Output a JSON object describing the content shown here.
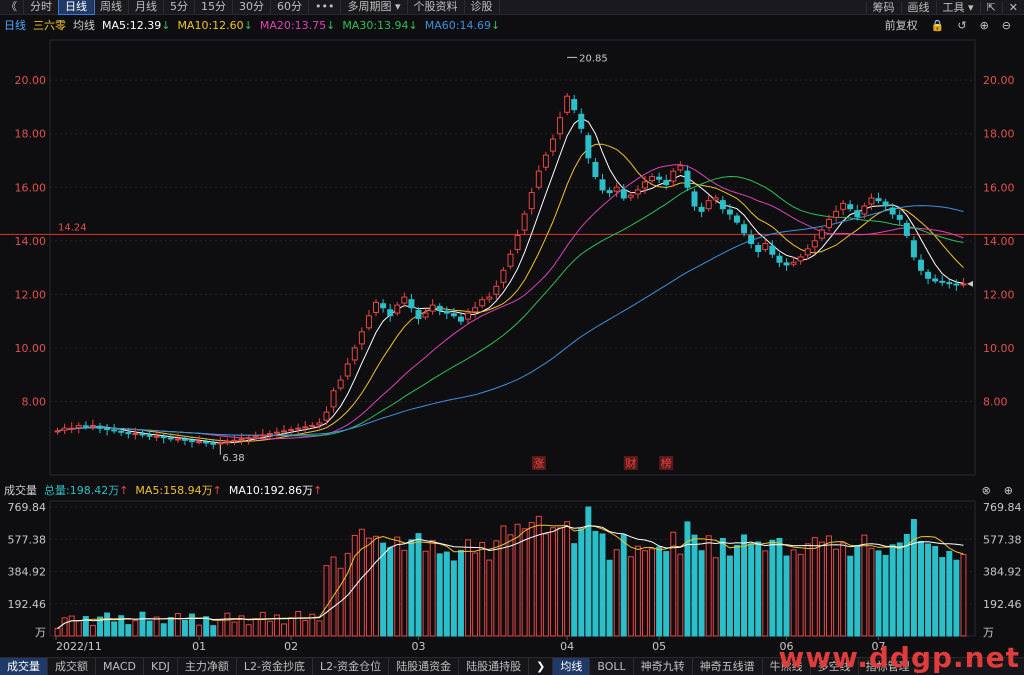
{
  "toolbar": {
    "back_glyph": "《",
    "tabs": [
      "分时",
      "日线",
      "周线",
      "月线",
      "5分",
      "15分",
      "30分",
      "60分",
      "•••",
      "多周期图 ▾",
      "个股资料",
      "诊股"
    ],
    "active_tab": "日线",
    "right": [
      "筹码",
      "画线",
      "工具 ▾"
    ]
  },
  "info": {
    "period": "日线",
    "name": "三六零",
    "ma_label": "均线",
    "ma5": "MA5:12.39",
    "ma10": "MA10:12.60",
    "ma20": "MA20:13.75",
    "ma30": "MA30:13.94",
    "ma60": "MA60:14.69",
    "adjust": "前复权"
  },
  "colors": {
    "up": "#e64545",
    "down": "#2bc0c9",
    "ma5": "#ffffff",
    "ma10": "#f2c12e",
    "ma20": "#e040b8",
    "ma30": "#2fbf5a",
    "ma60": "#3c90e0",
    "hline": "#d93636",
    "axis_text_red": "#e05050",
    "bg": "#0e0e10"
  },
  "chart_data": [
    {
      "type": "candlestick",
      "title": "",
      "ylim": [
        6,
        21.5
      ],
      "y_ticks": [
        "20.00",
        "18.00",
        "16.00",
        "14.00",
        "12.00",
        "10.00",
        "8.00"
      ],
      "x_ticks": [
        "2022/11",
        "01",
        "02",
        "03",
        "04",
        "05",
        "06",
        "07"
      ],
      "hline_value": "14.24",
      "max_label": "20.85",
      "min_label": "6.38",
      "event_markers": [
        "涨",
        "财",
        "榜"
      ],
      "close_series": [
        6.9,
        7.0,
        7.0,
        7.1,
        7.05,
        7.1,
        7.0,
        6.95,
        6.9,
        6.85,
        6.8,
        6.8,
        6.75,
        6.7,
        6.7,
        6.65,
        6.6,
        6.6,
        6.55,
        6.5,
        6.5,
        6.45,
        6.4,
        6.45,
        6.5,
        6.55,
        6.6,
        6.65,
        6.7,
        6.75,
        6.8,
        6.85,
        6.9,
        6.95,
        7.0,
        7.05,
        7.1,
        7.2,
        7.6,
        8.4,
        8.8,
        9.4,
        10.0,
        10.6,
        11.2,
        11.7,
        11.5,
        11.2,
        11.6,
        11.9,
        11.5,
        11.1,
        11.3,
        11.6,
        11.4,
        11.3,
        11.2,
        11.0,
        11.3,
        11.5,
        11.8,
        11.9,
        12.3,
        12.9,
        13.5,
        14.2,
        15.0,
        15.8,
        16.6,
        17.2,
        17.8,
        18.6,
        19.4,
        18.9,
        18.2,
        17.1,
        16.4,
        15.9,
        15.8,
        16.0,
        15.6,
        15.7,
        15.9,
        16.2,
        16.4,
        16.3,
        16.1,
        16.6,
        16.8,
        16.0,
        15.3,
        15.1,
        15.5,
        15.6,
        15.2,
        15.0,
        14.7,
        14.3,
        13.9,
        13.6,
        13.9,
        13.5,
        13.2,
        13.1,
        13.2,
        13.4,
        13.7,
        14.0,
        14.4,
        14.8,
        15.1,
        15.4,
        15.2,
        14.9,
        15.3,
        15.6,
        15.5,
        15.3,
        15.0,
        14.8,
        14.2,
        13.4,
        12.9,
        12.6,
        12.5,
        12.45,
        12.4,
        12.35,
        12.39
      ]
    },
    {
      "type": "bar",
      "title": "",
      "ylabel": "万",
      "ylim": [
        0,
        769.84
      ],
      "y_ticks": [
        "769.84",
        "577.38",
        "384.92",
        "192.46",
        "万"
      ],
      "total": "总量:198.42万",
      "ma5": "MA5:158.94万",
      "ma10": "MA10:192.86万"
    }
  ],
  "volume_info": {
    "label": "成交量",
    "total": "总量:198.42万",
    "ma5": "MA5:158.94万",
    "ma10": "MA10:192.86万"
  },
  "bottom_tabs": [
    "成交量",
    "成交额",
    "MACD",
    "KDJ",
    "主力净额",
    "L2-资金抄底",
    "L2-资金仓位",
    "陆股通资金",
    "陆股通持股",
    "❯",
    "均线",
    "BOLL",
    "神奇九转",
    "神奇五线谱",
    "牛熊线",
    "多空线",
    "指标管理"
  ],
  "active_bottom_tabs": [
    "成交量",
    "均线"
  ],
  "watermark": "www.ddgp.net"
}
